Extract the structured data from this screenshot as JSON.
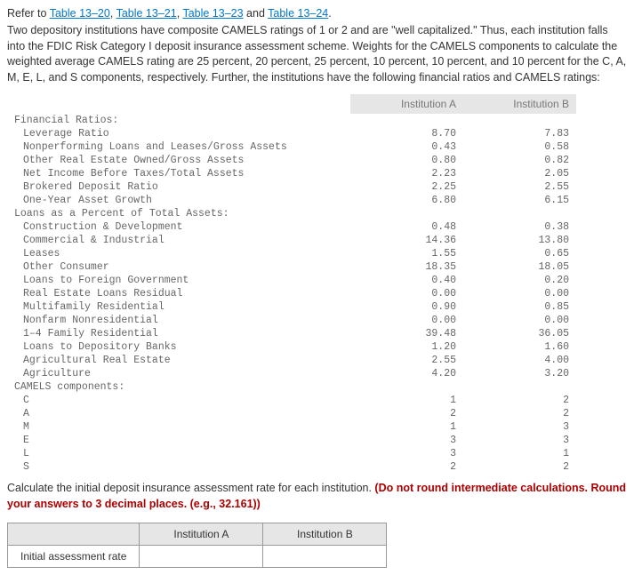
{
  "refer_prefix": "Refer to ",
  "refer_links": [
    "Table 13–20",
    "Table 13–21",
    "Table 13–23",
    "Table 13–24"
  ],
  "refer_and": " and ",
  "refer_period": ".",
  "paragraph": "Two depository institutions have composite CAMELS ratings of 1 or 2 and are \"well capitalized.\" Thus, each institution falls into the FDIC Risk Category I deposit insurance assessment scheme. Weights for the CAMELS components to calculate the weighted average CAMELS rating are 25 percent, 20 percent, 25 percent, 10 percent, 10 percent, and 10 percent for the C, A, M, E, L, and S components, respectively. Further, the institutions have the following financial ratios and CAMELS ratings:",
  "col_a": "Institution A",
  "col_b": "Institution B",
  "section1": "Financial Ratios:",
  "fr": {
    "leverage": {
      "label": "Leverage Ratio",
      "a": "8.70",
      "b": "7.83"
    },
    "npl": {
      "label": "Nonperforming Loans and Leases/Gross Assets",
      "a": "0.43",
      "b": "0.58"
    },
    "oreo": {
      "label": "Other Real Estate Owned/Gross Assets",
      "a": "0.80",
      "b": "0.82"
    },
    "nibt": {
      "label": "Net Income Before Taxes/Total Assets",
      "a": "2.23",
      "b": "2.05"
    },
    "brokered": {
      "label": "Brokered Deposit Ratio",
      "a": "2.25",
      "b": "2.55"
    },
    "oneyr": {
      "label": "One-Year Asset Growth",
      "a": "6.80",
      "b": "6.15"
    }
  },
  "section2": "Loans as a Percent of Total Assets:",
  "loans": {
    "cd": {
      "label": "Construction & Development",
      "a": "0.48",
      "b": "0.38"
    },
    "ci": {
      "label": "Commercial & Industrial",
      "a": "14.36",
      "b": "13.80"
    },
    "lease": {
      "label": "Leases",
      "a": "1.55",
      "b": "0.65"
    },
    "oc": {
      "label": "Other Consumer",
      "a": "18.35",
      "b": "18.05"
    },
    "lfg": {
      "label": "Loans to Foreign Government",
      "a": "0.40",
      "b": "0.20"
    },
    "rel": {
      "label": "Real Estate Loans Residual",
      "a": "0.00",
      "b": "0.00"
    },
    "mr": {
      "label": "Multifamily Residential",
      "a": "0.90",
      "b": "0.85"
    },
    "nn": {
      "label": "Nonfarm Nonresidential",
      "a": "0.00",
      "b": "0.00"
    },
    "fam": {
      "label": "1–4 Family Residential",
      "a": "39.48",
      "b": "36.05"
    },
    "ldb": {
      "label": "Loans to Depository Banks",
      "a": "1.20",
      "b": "1.60"
    },
    "are": {
      "label": "Agricultural Real Estate",
      "a": "2.55",
      "b": "4.00"
    },
    "ag": {
      "label": "Agriculture",
      "a": "4.20",
      "b": "3.20"
    }
  },
  "section3": "CAMELS components:",
  "camels": {
    "C": {
      "a": "1",
      "b": "2"
    },
    "A": {
      "a": "2",
      "b": "2"
    },
    "M": {
      "a": "1",
      "b": "3"
    },
    "E": {
      "a": "3",
      "b": "3"
    },
    "L": {
      "a": "3",
      "b": "1"
    },
    "S": {
      "a": "2",
      "b": "2"
    }
  },
  "calc_prefix": "Calculate the initial deposit insurance assessment rate for each institution. ",
  "calc_red": "(Do not round intermediate calculations. Round your answers to 3 decimal places. (e.g., 32.161))",
  "answer_row": "Initial assessment rate",
  "answer_headers": {
    "a": "Institution A",
    "b": "Institution B"
  }
}
